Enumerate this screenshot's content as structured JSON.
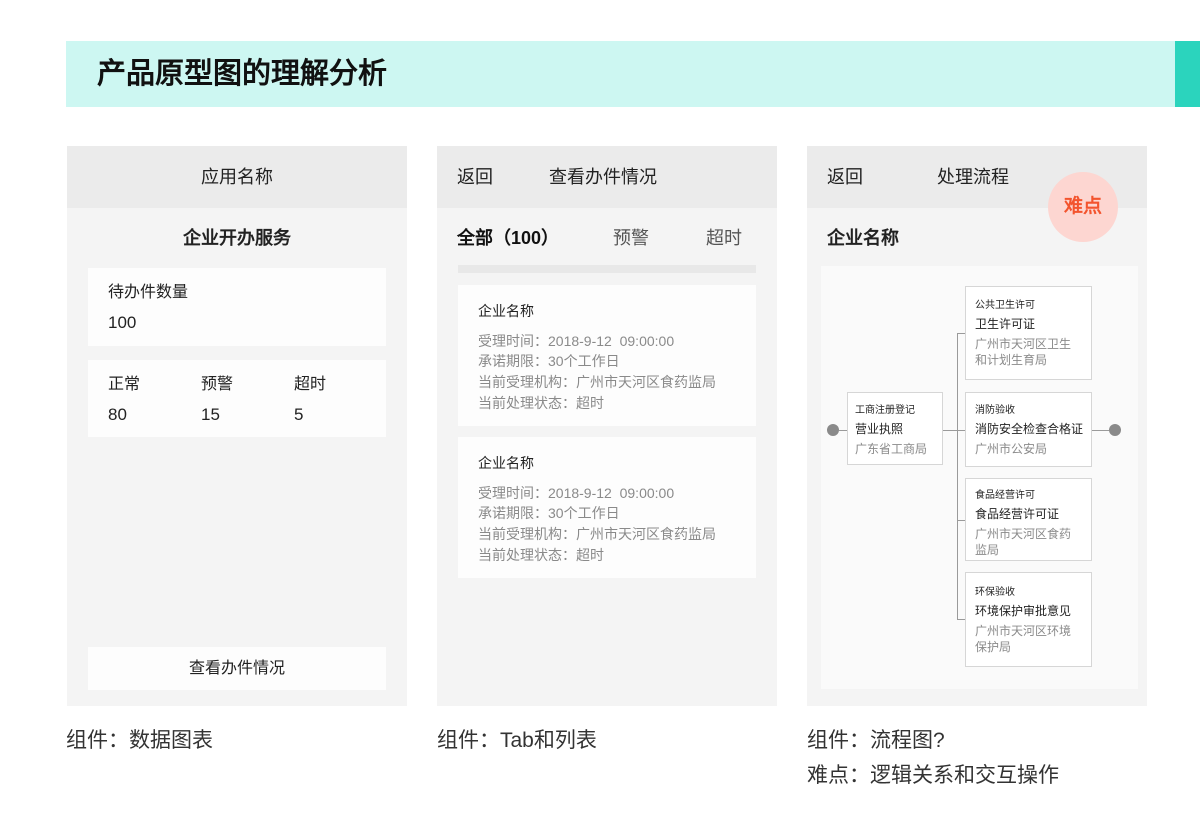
{
  "colors": {
    "banner_bg": "#cdf7f2",
    "accent": "#2bd4bd",
    "panel_bg": "#f4f4f4",
    "header_bg": "#ebebeb",
    "card_bg": "#fdfdfd",
    "text": "#222222",
    "muted_text": "#8a8a8a",
    "badge_bg": "#fdd6d1",
    "badge_text": "#f3542e"
  },
  "banner": {
    "title": "产品原型图的理解分析"
  },
  "panel1": {
    "header_title": "应用名称",
    "service_name": "企业开办服务",
    "pending": {
      "label": "待办件数量",
      "value": "100"
    },
    "stats": [
      {
        "label": "正常",
        "value": "80"
      },
      {
        "label": "预警",
        "value": "15"
      },
      {
        "label": "超时",
        "value": "5"
      }
    ],
    "button_label": "查看办件情况",
    "caption": "组件：数据图表"
  },
  "panel2": {
    "back_label": "返回",
    "header_title": "查看办件情况",
    "tabs": [
      {
        "label": "全部（100）",
        "active": true
      },
      {
        "label": "预警",
        "active": false
      },
      {
        "label": "超时",
        "active": false
      }
    ],
    "cards": [
      {
        "title": "企业名称",
        "lines": [
          "受理时间：2018-9-12  09:00:00",
          "承诺期限：30个工作日",
          "当前受理机构：广州市天河区食药监局",
          "当前处理状态：超时"
        ]
      },
      {
        "title": "企业名称",
        "lines": [
          "受理时间：2018-9-12  09:00:00",
          "承诺期限：30个工作日",
          "当前受理机构：广州市天河区食药监局",
          "当前处理状态：超时"
        ]
      }
    ],
    "caption": "组件：Tab和列表"
  },
  "panel3": {
    "back_label": "返回",
    "header_title": "处理流程",
    "badge": "难点",
    "company_name": "企业名称",
    "flow": {
      "start": {
        "category": "工商注册登记",
        "document": "营业执照",
        "authority_lines": [
          "广东省工商局"
        ]
      },
      "branches": [
        {
          "category": "公共卫生许可",
          "document": "卫生许可证",
          "authority_lines": [
            "广州市天河区卫生",
            "和计划生育局"
          ]
        },
        {
          "category": "消防验收",
          "document": "消防安全检查合格证",
          "authority_lines": [
            "广州市公安局"
          ]
        },
        {
          "category": "食品经营许可",
          "document": "食品经营许可证",
          "authority_lines": [
            "广州市天河区食药",
            "监局"
          ]
        },
        {
          "category": "环保验收",
          "document": "环境保护审批意见",
          "authority_lines": [
            "广州市天河区环境",
            "保护局"
          ]
        }
      ]
    },
    "captions": [
      "组件：流程图?",
      "难点：逻辑关系和交互操作"
    ]
  }
}
